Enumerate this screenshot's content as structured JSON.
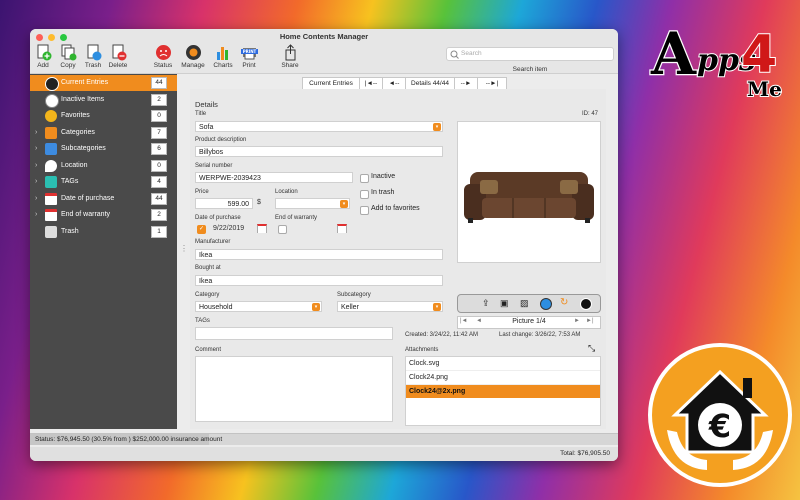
{
  "window": {
    "title": "Home Contents Manager"
  },
  "toolbar": {
    "add": "Add",
    "copy": "Copy",
    "trash": "Trash",
    "delete": "Delete",
    "status": "Status",
    "manage": "Manage",
    "charts": "Charts",
    "print": "Print",
    "share": "Share",
    "print_badge": "PRINT"
  },
  "search": {
    "placeholder": "Search",
    "label": "Search item"
  },
  "sidebar": {
    "items": [
      {
        "label": "Current Entries",
        "count": "44"
      },
      {
        "label": "Inactive Items",
        "count": "2"
      },
      {
        "label": "Favorites",
        "count": "0"
      },
      {
        "label": "Categories",
        "count": "7"
      },
      {
        "label": "Subcategories",
        "count": "6"
      },
      {
        "label": "Location",
        "count": "0"
      },
      {
        "label": "TAGs",
        "count": "4"
      },
      {
        "label": "Date of purchase",
        "count": "44"
      },
      {
        "label": "End of warranty",
        "count": "2"
      },
      {
        "label": "Trash",
        "count": "1"
      }
    ]
  },
  "nav": {
    "current": "Current Entries",
    "first": "|◄--",
    "prev": "◄--",
    "details": "Details 44/44",
    "next": "--►",
    "last": "--►|"
  },
  "details": {
    "heading": "Details",
    "id_label": "ID: 47",
    "title_label": "Title",
    "title": "Sofa",
    "desc_label": "Product description",
    "desc": "Billybos",
    "serial_label": "Serial number",
    "serial": "WERPWE-2039423",
    "price_label": "Price",
    "price": "599.00",
    "currency": "$",
    "location_label": "Location",
    "location": "",
    "inactive": "Inactive",
    "in_trash": "In trash",
    "add_fav": "Add to favorites",
    "dop_label": "Date of purchase",
    "dop": "9/22/2019",
    "eow_label": "End of warranty",
    "manufacturer_label": "Manufacturer",
    "manufacturer": "Ikea",
    "bought_label": "Bought at",
    "bought": "Ikea",
    "category_label": "Category",
    "category": "Household",
    "subcategory_label": "Subcategory",
    "subcategory": "Keller",
    "tags_label": "TAGs",
    "created": "Created: 3/24/22, 11:42 AM",
    "changed": "Last change: 3/26/22, 7:53 AM",
    "comment_label": "Comment",
    "attachments_label": "Attachments",
    "attachments": [
      "Clock.svg",
      "Clock24.png",
      "Clock24@2x.png"
    ],
    "picture": "Picture 1/4"
  },
  "status": {
    "text": "Status: $76,945.50 (30.5% from ) $252,000.00 insurance amount",
    "total": "Total: $76,905.50",
    "percent": 30.5
  },
  "brand": {
    "logo_text": "Apps4Me",
    "accent": "#f08c1e",
    "active_bg": "#f08c1e"
  }
}
